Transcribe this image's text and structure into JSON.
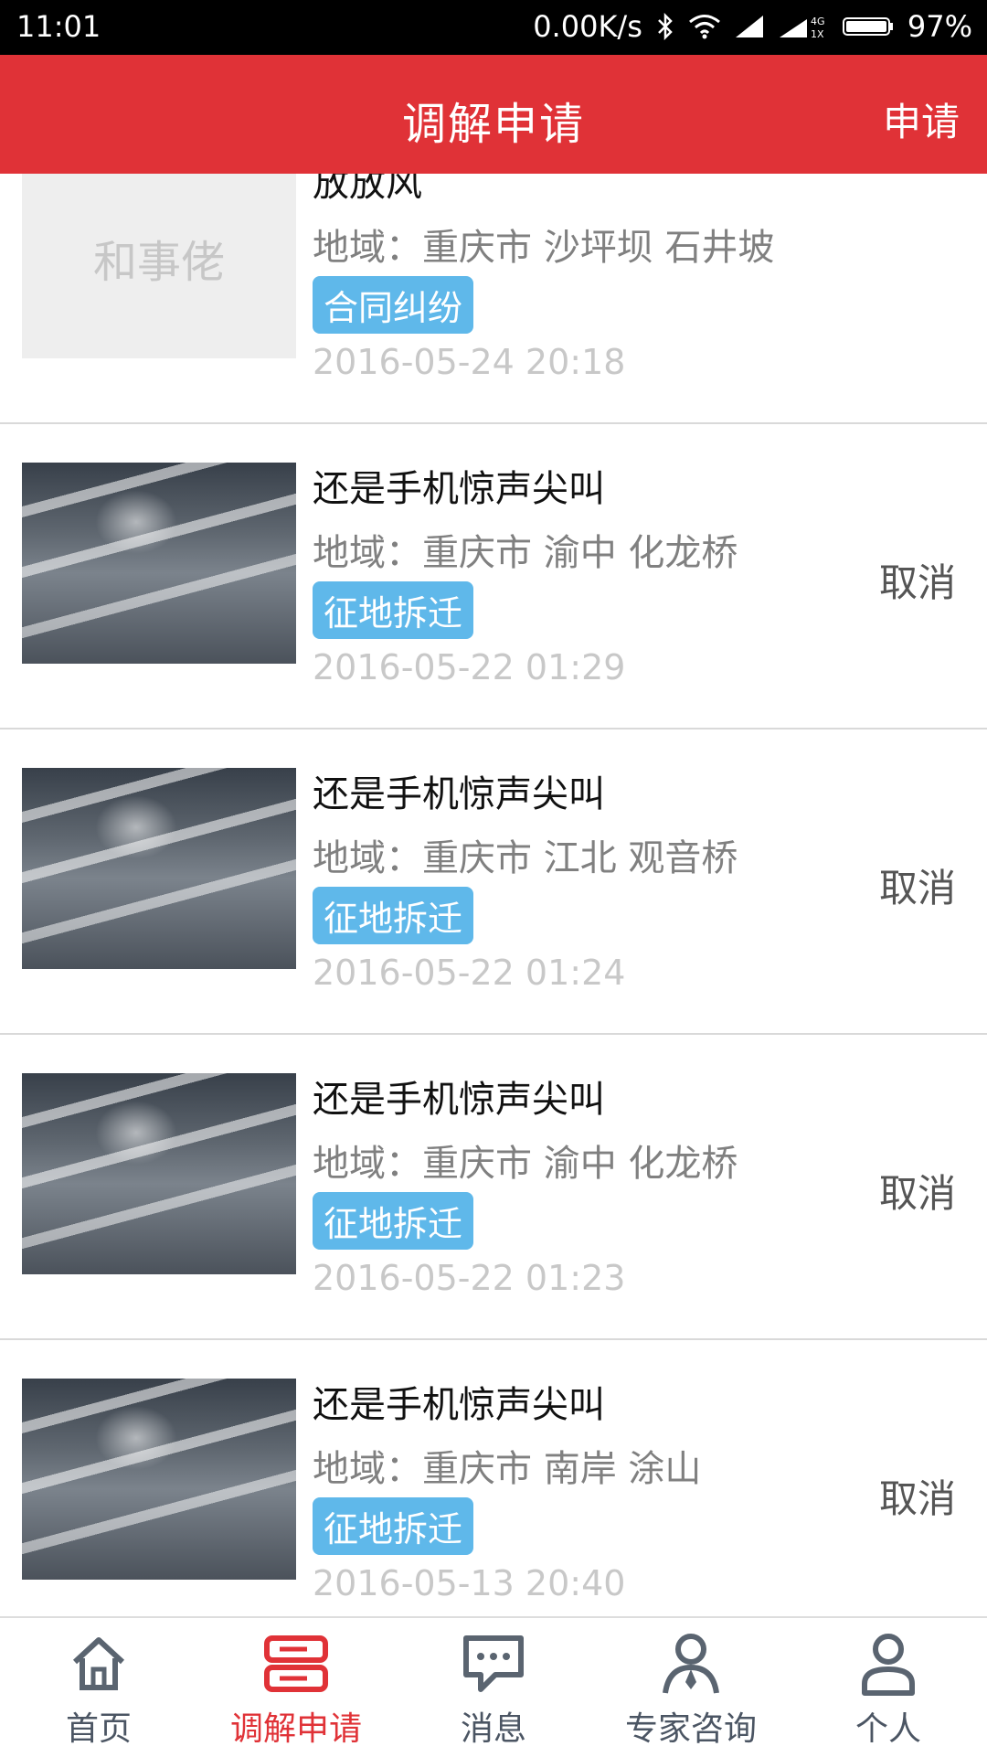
{
  "statusbar": {
    "time": "11:01",
    "net_speed": "0.00K/s",
    "battery": "97%",
    "icons": [
      "bluetooth-icon",
      "wifi-icon",
      "signal-icon",
      "4g-signal-icon",
      "battery-icon"
    ]
  },
  "header": {
    "title": "调解申请",
    "action": "申请"
  },
  "thumb_placeholder_text": "和事佬",
  "items": [
    {
      "title": "放放风",
      "region": "地域：重庆市 沙坪坝 石井坡",
      "tag": "合同纠纷",
      "date": "2016-05-24 20:18",
      "cancel": "",
      "thumb": "placeholder"
    },
    {
      "title": "还是手机惊声尖叫",
      "region": "地域：重庆市 渝中 化龙桥",
      "tag": "征地拆迁",
      "date": "2016-05-22 01:29",
      "cancel": "取消",
      "thumb": "photo"
    },
    {
      "title": "还是手机惊声尖叫",
      "region": "地域：重庆市 江北 观音桥",
      "tag": "征地拆迁",
      "date": "2016-05-22 01:24",
      "cancel": "取消",
      "thumb": "photo"
    },
    {
      "title": "还是手机惊声尖叫",
      "region": "地域：重庆市 渝中 化龙桥",
      "tag": "征地拆迁",
      "date": "2016-05-22 01:23",
      "cancel": "取消",
      "thumb": "photo"
    },
    {
      "title": "还是手机惊声尖叫",
      "region": "地域：重庆市 南岸 涂山",
      "tag": "征地拆迁",
      "date": "2016-05-13 20:40",
      "cancel": "取消",
      "thumb": "photo"
    }
  ],
  "tabs": [
    {
      "label": "首页",
      "icon": "home-icon",
      "active": false
    },
    {
      "label": "调解申请",
      "icon": "mediation-icon",
      "active": true
    },
    {
      "label": "消息",
      "icon": "message-icon",
      "active": false
    },
    {
      "label": "专家咨询",
      "icon": "expert-icon",
      "active": false
    },
    {
      "label": "个人",
      "icon": "person-icon",
      "active": false
    }
  ],
  "colors": {
    "brand_red": "#e03237",
    "tag_blue": "#5fb8ea"
  }
}
